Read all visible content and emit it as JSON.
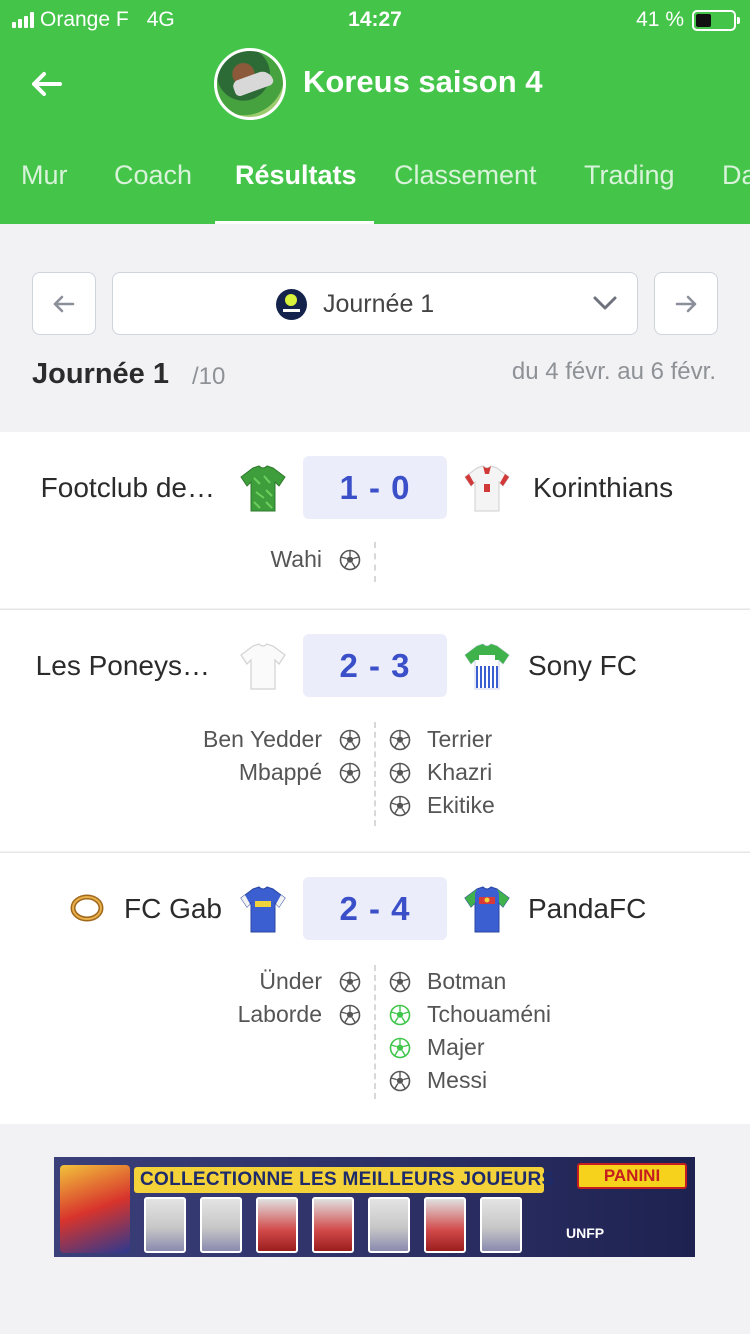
{
  "status_bar": {
    "carrier": "Orange F",
    "network": "4G",
    "time": "14:27",
    "battery": "41 %",
    "battery_level": 0.41
  },
  "header": {
    "title": "Koreus saison 4",
    "back_icon": "arrow-left-icon",
    "avatar_icon": "league-avatar"
  },
  "tabs": [
    {
      "label": "Mur"
    },
    {
      "label": "Coach"
    },
    {
      "label": "Résultats",
      "active": true
    },
    {
      "label": "Classement"
    },
    {
      "label": "Trading"
    },
    {
      "label": "Da"
    }
  ],
  "round_selector": {
    "selected": "Journée 1",
    "prev_icon": "arrow-left-icon",
    "next_icon": "arrow-right-icon",
    "dropdown_icon": "chevron-down-icon"
  },
  "round": {
    "title": "Journée 1",
    "total": "/10",
    "dates": "du 4 févr. au 6 févr."
  },
  "matches": [
    {
      "home": "Footclub de…",
      "away": "Korinthians",
      "score": "1 - 0",
      "home_scorers": [
        "Wahi"
      ],
      "away_scorers": []
    },
    {
      "home": "Les Poneys…",
      "away": "Sony FC",
      "score": "2 - 3",
      "home_scorers": [
        "Ben Yedder",
        "Mbappé"
      ],
      "away_scorers": [
        "Terrier",
        "Khazri",
        "Ekitike"
      ]
    },
    {
      "home": "FC Gab",
      "away": "PandaFC",
      "score": "2 - 4",
      "home_scorers": [
        "Ünder",
        "Laborde"
      ],
      "away_scorers": [
        "Botman",
        "Tchouaméni",
        "Majer",
        "Messi"
      ]
    }
  ],
  "banner": {
    "headline": "COLLECTIONNE LES MEILLEURS JOUEURS",
    "brand": "PANINI",
    "partner": "UNFP"
  },
  "colors": {
    "brand_green": "#44c54a",
    "score_blue": "#3a4fc8",
    "score_bg": "#ebedfb",
    "bonus_goal_green": "#3fc54a"
  }
}
